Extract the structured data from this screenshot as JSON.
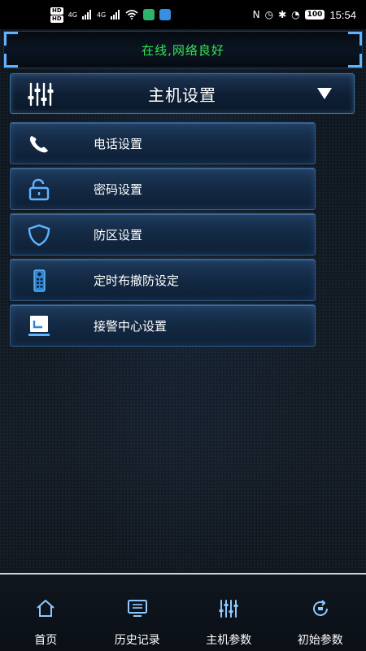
{
  "status_bar": {
    "hd_badge_1": "HD",
    "hd_badge_2": "HD",
    "signal_1": "4G",
    "signal_2": "4G",
    "battery": "100",
    "time": "15:54"
  },
  "network_status": {
    "text": "在线,网络良好",
    "color": "#33e64d"
  },
  "host_header": {
    "title": "主机设置"
  },
  "menu": {
    "items": [
      {
        "label": "电话设置",
        "icon": "phone-icon"
      },
      {
        "label": "密码设置",
        "icon": "unlock-icon"
      },
      {
        "label": "防区设置",
        "icon": "shield-icon"
      },
      {
        "label": "定时布撤防设定",
        "icon": "remote-control-icon"
      },
      {
        "label": "接警中心设置",
        "icon": "monitor-icon"
      }
    ]
  },
  "bottom_nav": {
    "items": [
      {
        "label": "首页",
        "icon": "home-icon"
      },
      {
        "label": "历史记录",
        "icon": "history-monitor-icon"
      },
      {
        "label": "主机参数",
        "icon": "sliders-icon"
      },
      {
        "label": "初始参数",
        "icon": "reset-icon"
      }
    ]
  },
  "colors": {
    "accent_blue": "#5fb4ff",
    "panel_border": "#2f5a84",
    "online_green": "#33e64d"
  }
}
